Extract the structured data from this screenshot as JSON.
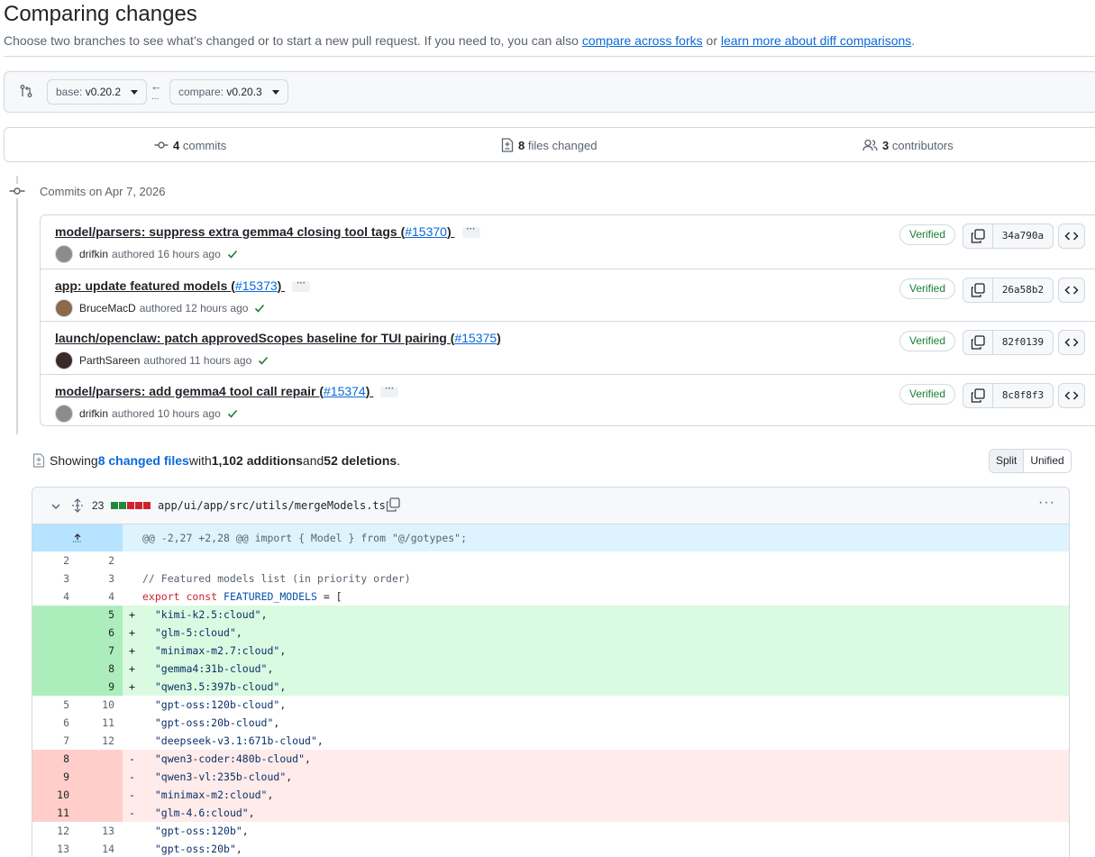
{
  "page": {
    "title": "Comparing changes",
    "subtitle_prefix": "Choose two branches to see what’s changed or to start a new pull request. If you need to, you can also ",
    "compare_forks_link": "compare across forks",
    "subtitle_or": " or ",
    "learn_more_link": "learn more about diff comparisons",
    "subtitle_suffix": "."
  },
  "branches": {
    "base_label": "base: ",
    "base_value": "v0.20.2",
    "compare_label": "compare: ",
    "compare_value": "v0.20.3",
    "arrow": "←",
    "dots": "..."
  },
  "stats": {
    "commits_count": "4",
    "commits_label": " commits",
    "files_count": "8",
    "files_label": " files changed",
    "contributors_count": "3",
    "contributors_label": " contributors"
  },
  "timeline": {
    "date_label": "Commits on Apr 7, 2026"
  },
  "commits": [
    {
      "title": "model/parsers: suppress extra gemma4 closing tool tags (",
      "pr": "#15370",
      "title_end": ")",
      "has_more": true,
      "author": "drifkin",
      "authored": "authored 16 hours ago",
      "verified": "Verified",
      "sha": "34a790a",
      "avatar_color": "#8c8c8c"
    },
    {
      "title": "app: update featured models (",
      "pr": "#15373",
      "title_end": ")",
      "has_more": true,
      "author": "BruceMacD",
      "authored": "authored 12 hours ago",
      "verified": "Verified",
      "sha": "26a58b2",
      "avatar_color": "#8a6a4a"
    },
    {
      "title": "launch/openclaw: patch approvedScopes baseline for TUI pairing (",
      "pr": "#15375",
      "title_end": ")",
      "has_more": false,
      "author": "ParthSareen",
      "authored": "authored 11 hours ago",
      "verified": "Verified",
      "sha": "82f0139",
      "avatar_color": "#3a2a2a"
    },
    {
      "title": "model/parsers: add gemma4 tool call repair (",
      "pr": "#15374",
      "title_end": ")",
      "has_more": true,
      "author": "drifkin",
      "authored": "authored 10 hours ago",
      "verified": "Verified",
      "sha": "8c8f8f3",
      "avatar_color": "#8c8c8c"
    }
  ],
  "summary": {
    "showing": "Showing ",
    "changed_files": "8 changed files",
    "with": " with ",
    "additions": "1,102 additions",
    "and": " and ",
    "deletions": "52 deletions",
    "period": "."
  },
  "view_toggle": {
    "split": "Split",
    "unified": "Unified"
  },
  "file": {
    "changes": "23",
    "path": "app/ui/app/src/utils/mergeModels.ts",
    "diffstat_colors": [
      "#1f883d",
      "#1f883d",
      "#cf222e",
      "#cf222e",
      "#cf222e"
    ],
    "hunk_header": "@@ -2,27 +2,28 @@ import { Model } from \"@/gotypes\";",
    "lines": [
      {
        "type": "ctx",
        "old": "2",
        "new": "2",
        "marker": " ",
        "code": ""
      },
      {
        "type": "ctx",
        "old": "3",
        "new": "3",
        "marker": " ",
        "code": "// Featured models list (in priority order)"
      },
      {
        "type": "ctx",
        "old": "4",
        "new": "4",
        "marker": " ",
        "code": "export const FEATURED_MODELS = ["
      },
      {
        "type": "add",
        "old": "",
        "new": "5",
        "marker": "+",
        "code": "  \"kimi-k2.5:cloud\","
      },
      {
        "type": "add",
        "old": "",
        "new": "6",
        "marker": "+",
        "code": "  \"glm-5:cloud\","
      },
      {
        "type": "add",
        "old": "",
        "new": "7",
        "marker": "+",
        "code": "  \"minimax-m2.7:cloud\","
      },
      {
        "type": "add",
        "old": "",
        "new": "8",
        "marker": "+",
        "code": "  \"gemma4:31b-cloud\","
      },
      {
        "type": "add",
        "old": "",
        "new": "9",
        "marker": "+",
        "code": "  \"qwen3.5:397b-cloud\","
      },
      {
        "type": "ctx",
        "old": "5",
        "new": "10",
        "marker": " ",
        "code": "  \"gpt-oss:120b-cloud\","
      },
      {
        "type": "ctx",
        "old": "6",
        "new": "11",
        "marker": " ",
        "code": "  \"gpt-oss:20b-cloud\","
      },
      {
        "type": "ctx",
        "old": "7",
        "new": "12",
        "marker": " ",
        "code": "  \"deepseek-v3.1:671b-cloud\","
      },
      {
        "type": "del",
        "old": "8",
        "new": "",
        "marker": "-",
        "code": "  \"qwen3-coder:480b-cloud\","
      },
      {
        "type": "del",
        "old": "9",
        "new": "",
        "marker": "-",
        "code": "  \"qwen3-vl:235b-cloud\","
      },
      {
        "type": "del",
        "old": "10",
        "new": "",
        "marker": "-",
        "code": "  \"minimax-m2:cloud\","
      },
      {
        "type": "del",
        "old": "11",
        "new": "",
        "marker": "-",
        "code": "  \"glm-4.6:cloud\","
      },
      {
        "type": "ctx",
        "old": "12",
        "new": "13",
        "marker": " ",
        "code": "  \"gpt-oss:120b\","
      },
      {
        "type": "ctx",
        "old": "13",
        "new": "14",
        "marker": " ",
        "code": "  \"gpt-oss:20b\","
      }
    ]
  }
}
